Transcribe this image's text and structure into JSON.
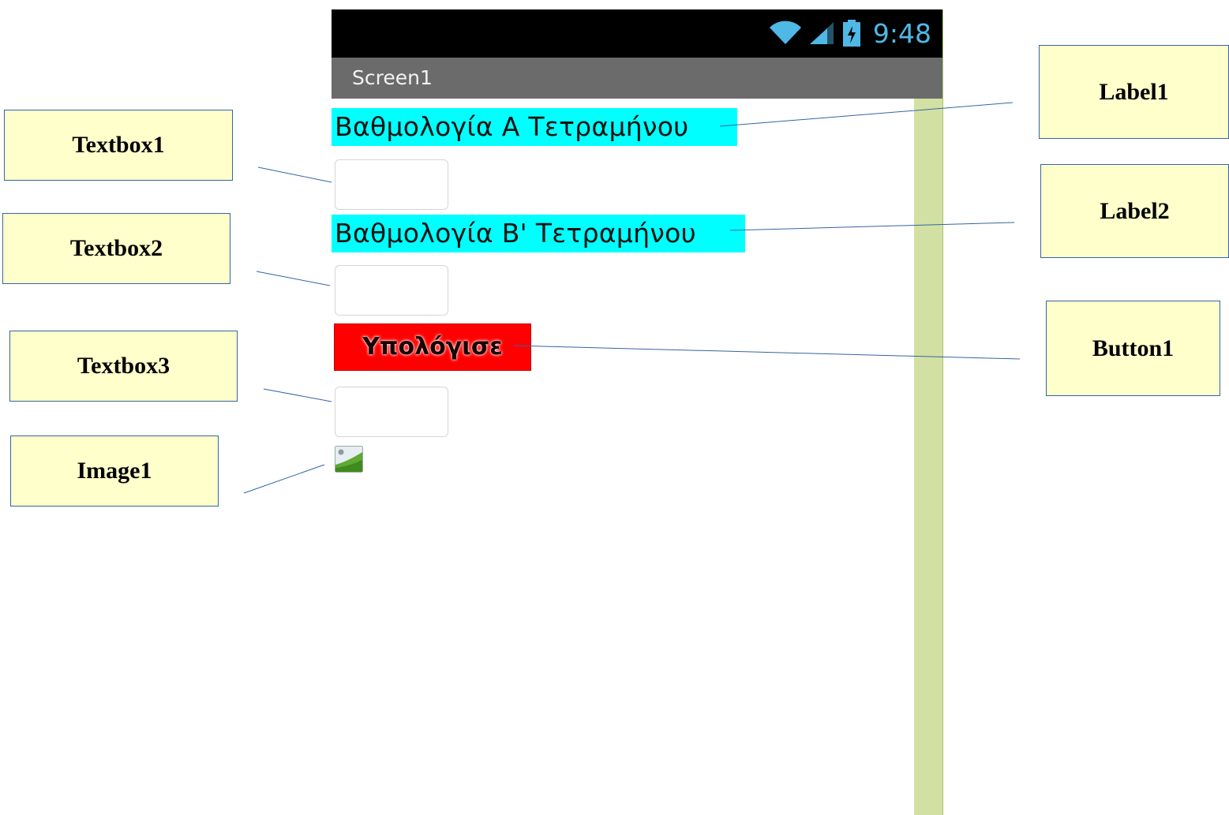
{
  "status_bar": {
    "time": "9:48",
    "icons": [
      "wifi-icon",
      "cell-signal-icon",
      "battery-charging-icon"
    ],
    "icon_color": "#4fb8e6"
  },
  "screen": {
    "title": "Screen1"
  },
  "components": {
    "label1": {
      "text": "Βαθμολογία Α Τετραμήνου",
      "background": "#00ffff"
    },
    "textbox1": {
      "value": ""
    },
    "label2": {
      "text": "Βαθμολογία Β' Τετραμήνου",
      "background": "#00ffff"
    },
    "textbox2": {
      "value": ""
    },
    "button1": {
      "label": "Υπολόγισε",
      "background": "#ff0000"
    },
    "textbox3": {
      "value": ""
    },
    "image1": {
      "icon": "image-placeholder-icon"
    }
  },
  "callouts": {
    "textbox1": "Textbox1",
    "textbox2": "Textbox2",
    "textbox3": "Textbox3",
    "image1": "Image1",
    "label1": "Label1",
    "label2": "Label2",
    "button1": "Button1"
  },
  "colors": {
    "callout_fill": "#ffffcc",
    "callout_border": "#3465a4",
    "side_strip": "#d3e0a4"
  }
}
